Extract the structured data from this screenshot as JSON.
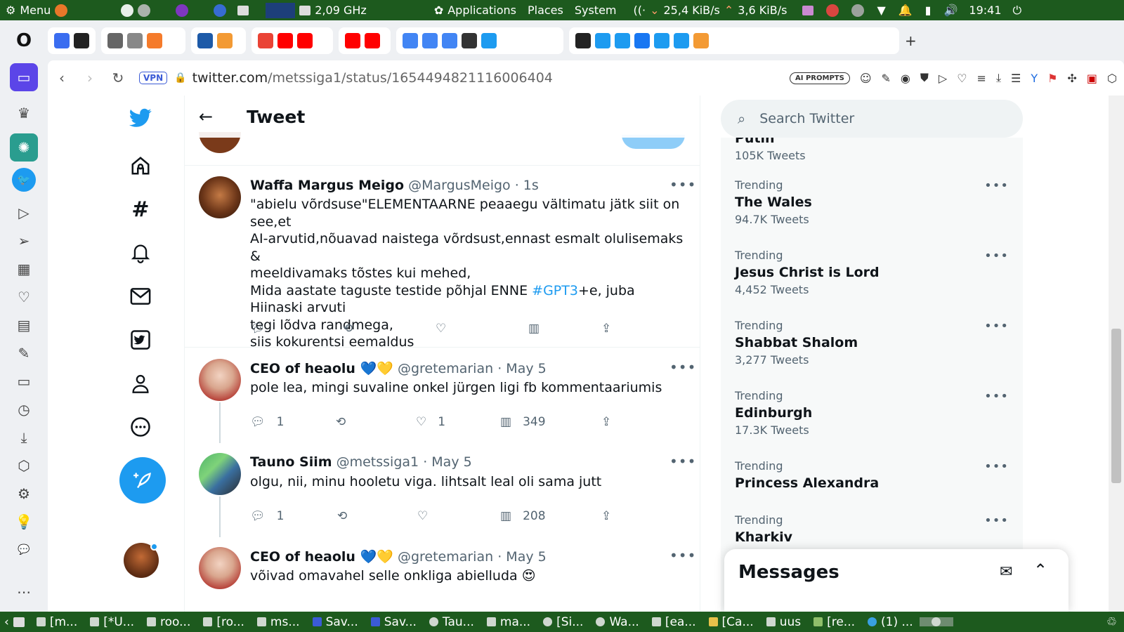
{
  "system_bar": {
    "menu": "Menu",
    "cpu": "2,09 GHz",
    "applications": "Applications",
    "places": "Places",
    "system": "System",
    "net_down": "25,4 KiB/s",
    "net_up": "3,6 KiB/s",
    "time": "19:41"
  },
  "address_bar": {
    "vpn": "VPN",
    "domain": "twitter.com",
    "path": "/metssiga1/status/1654494821116006404",
    "ai_prompts": "AI PROMPTS"
  },
  "header": {
    "title": "Tweet"
  },
  "tweets": [
    {
      "name": "Waffa Margus Meigo",
      "handle": "@MargusMeigo",
      "time": "1s",
      "text_before_tag": "\"abielu võrdsuse\"ELEMENTAARNE peaaegu vältimatu jätk siit on see,et\nAI-arvutid,nõuavad naistega võrdsust,ennast esmalt olulisemaks &\nmeeldivamaks tõstes kui mehed,\nMida aastate taguste testide põhjal ENNE ",
      "hashtag": "#GPT3",
      "text_after_tag": "+e, juba Hiinaski arvuti\ntegi lõdva randmega,\nsiis kokurentsi eemaldus",
      "replies": "",
      "retweets": "",
      "likes": "",
      "views": ""
    },
    {
      "name": "CEO of heaolu 💙💛",
      "handle": "@gretemarian",
      "time": "May 5",
      "text": "pole lea, mingi suvaline onkel jürgen ligi fb kommentaariumis",
      "replies": "1",
      "retweets": "",
      "likes": "1",
      "views": "349"
    },
    {
      "name": "Tauno Siim",
      "handle": "@metssiga1",
      "time": "May 5",
      "text": "olgu, nii, minu hooletu viga. lihtsalt leal oli sama jutt",
      "replies": "1",
      "retweets": "",
      "likes": "",
      "views": "208"
    },
    {
      "name": "CEO of heaolu 💙💛",
      "handle": "@gretemarian",
      "time": "May 5",
      "text": "võivad omavahel selle onkliga abielluda 😍"
    }
  ],
  "search": {
    "placeholder": "Search Twitter"
  },
  "trends": [
    {
      "label": "",
      "title": "Putin",
      "count": "105K Tweets"
    },
    {
      "label": "Trending",
      "title": "The Wales",
      "count": "94.7K Tweets"
    },
    {
      "label": "Trending",
      "title": "Jesus Christ is Lord",
      "count": "4,452 Tweets"
    },
    {
      "label": "Trending",
      "title": "Shabbat Shalom",
      "count": "3,277 Tweets"
    },
    {
      "label": "Trending",
      "title": "Edinburgh",
      "count": "17.3K Tweets"
    },
    {
      "label": "Trending",
      "title": "Princess Alexandra",
      "count": ""
    },
    {
      "label": "Trending",
      "title": "Kharkiv",
      "count": ""
    }
  ],
  "messages": {
    "title": "Messages"
  },
  "taskbar": {
    "items": [
      "[m...",
      "[*U...",
      "roo...",
      "[ro...",
      "ms...",
      "Sav...",
      "Sav...",
      "Tau...",
      "ma...",
      "[Si...",
      "Wa...",
      "[ea...",
      "[Ca...",
      "uus",
      "[re...",
      "(1) ..."
    ]
  }
}
